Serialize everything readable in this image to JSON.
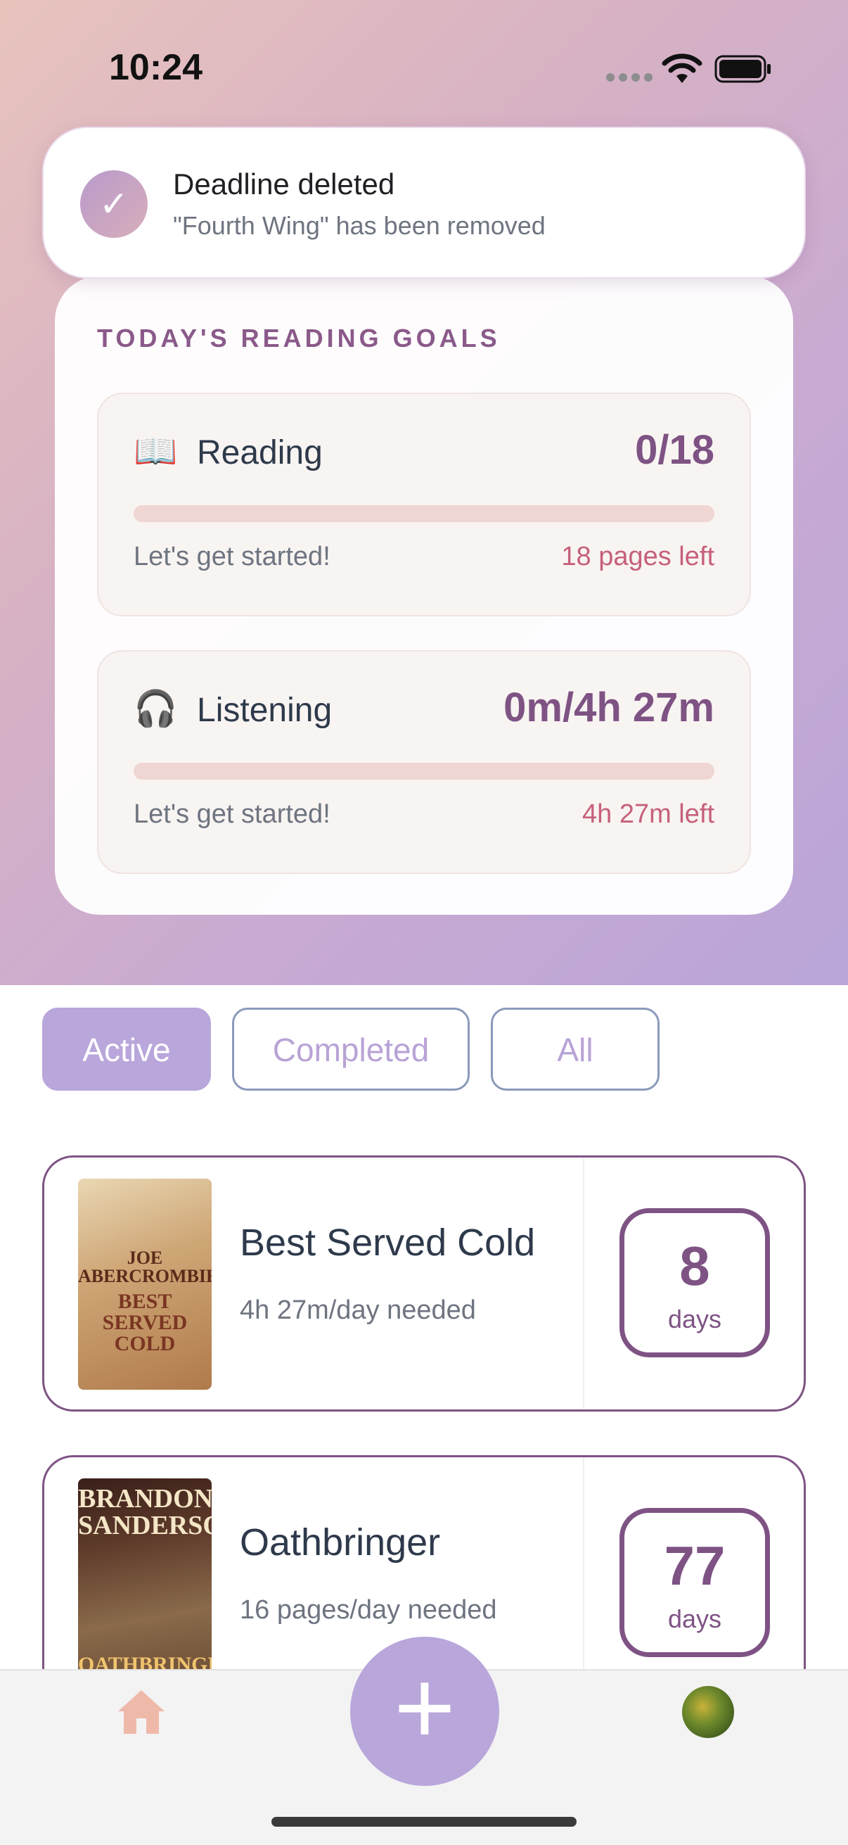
{
  "status_bar": {
    "time": "10:24"
  },
  "toast": {
    "title": "Deadline deleted",
    "message": "\"Fourth Wing\" has been removed",
    "icon": "checkmark-icon"
  },
  "goals": {
    "section_title": "TODAY'S READING GOALS",
    "reading": {
      "icon": "📖",
      "label": "Reading",
      "value": "0/18",
      "progress": 0,
      "status": "Let's get started!",
      "remaining": "18 pages left"
    },
    "listening": {
      "icon": "🎧",
      "label": "Listening",
      "value": "0m/4h 27m",
      "progress": 0,
      "status": "Let's get started!",
      "remaining": "4h 27m left"
    }
  },
  "filters": {
    "active": "Active",
    "completed": "Completed",
    "all": "All",
    "selected": "Active"
  },
  "books": [
    {
      "title": "Best Served Cold",
      "needed": "4h 27m/day needed",
      "days": "8",
      "days_unit": "days",
      "cover_author": "JOE ABERCROMBIE",
      "cover_title": "BEST SERVED COLD"
    },
    {
      "title": "Oathbringer",
      "needed": "16 pages/day needed",
      "days": "77",
      "days_unit": "days",
      "cover_author": "BRANDON SANDERSON",
      "cover_title": "OATHBRINGER"
    }
  ],
  "tabbar": {
    "add_symbol": "+",
    "home_icon": "home-icon",
    "profile_icon": "avatar"
  },
  "colors": {
    "accent": "#7e5384",
    "filter_active": "#b9a6db",
    "remaining_text": "#c6607c"
  }
}
